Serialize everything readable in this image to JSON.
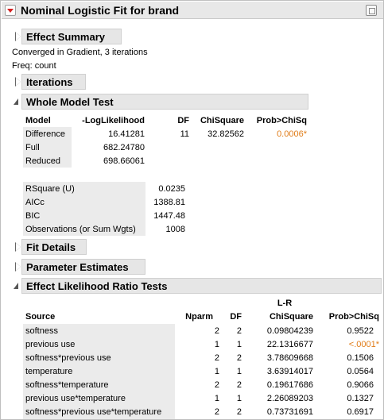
{
  "report": {
    "title": "Nominal Logistic Fit for brand",
    "outlines": {
      "effect_summary": "Effect Summary",
      "iterations": "Iterations",
      "whole_model_test": "Whole Model Test",
      "fit_details": "Fit Details",
      "parameter_estimates": "Parameter Estimates",
      "effect_lr_tests": "Effect Likelihood Ratio Tests"
    },
    "notes": {
      "converged": "Converged in Gradient, 3 iterations",
      "freq": "Freq: count"
    }
  },
  "whole_model": {
    "headers": [
      "Model",
      "-LogLikelihood",
      "DF",
      "ChiSquare",
      "Prob>ChiSq"
    ],
    "rows": [
      {
        "model": "Difference",
        "loglik": "16.41281",
        "df": "11",
        "chisq": "32.82562",
        "prob": "0.0006*"
      },
      {
        "model": "Full",
        "loglik": "682.24780",
        "df": "",
        "chisq": "",
        "prob": ""
      },
      {
        "model": "Reduced",
        "loglik": "698.66061",
        "df": "",
        "chisq": "",
        "prob": ""
      }
    ],
    "stats": [
      {
        "label": "RSquare (U)",
        "value": "0.0235"
      },
      {
        "label": "AICc",
        "value": "1388.81"
      },
      {
        "label": "BIC",
        "value": "1447.48"
      },
      {
        "label": "Observations (or Sum Wgts)",
        "value": "1008"
      }
    ]
  },
  "lr_tests": {
    "headers": {
      "source": "Source",
      "nparm": "Nparm",
      "df": "DF",
      "lr_top": "L-R",
      "lr_bottom": "ChiSquare",
      "prob": "Prob>ChiSq"
    },
    "rows": [
      {
        "source": "softness",
        "nparm": "2",
        "df": "2",
        "chisq": "0.09804239",
        "prob": "0.9522"
      },
      {
        "source": "previous use",
        "nparm": "1",
        "df": "1",
        "chisq": "22.1316677",
        "prob": "<.0001*"
      },
      {
        "source": "softness*previous use",
        "nparm": "2",
        "df": "2",
        "chisq": "3.78609668",
        "prob": "0.1506"
      },
      {
        "source": "temperature",
        "nparm": "1",
        "df": "1",
        "chisq": "3.63914017",
        "prob": "0.0564"
      },
      {
        "source": "softness*temperature",
        "nparm": "2",
        "df": "2",
        "chisq": "0.19617686",
        "prob": "0.9066"
      },
      {
        "source": "previous use*temperature",
        "nparm": "1",
        "df": "1",
        "chisq": "2.26089203",
        "prob": "0.1327"
      },
      {
        "source": "softness*previous use*temperature",
        "nparm": "2",
        "df": "2",
        "chisq": "0.73731691",
        "prob": "0.6917"
      }
    ]
  },
  "colors": {
    "significant": "#e07c18",
    "header_bg": "#e6e6e6",
    "menu_triangle": "#d42020"
  },
  "icons": {
    "menu": "red-triangle-menu-icon",
    "collapsed": "disclosure-right-icon",
    "expanded": "disclosure-down-icon",
    "window": "window-restore-icon"
  }
}
